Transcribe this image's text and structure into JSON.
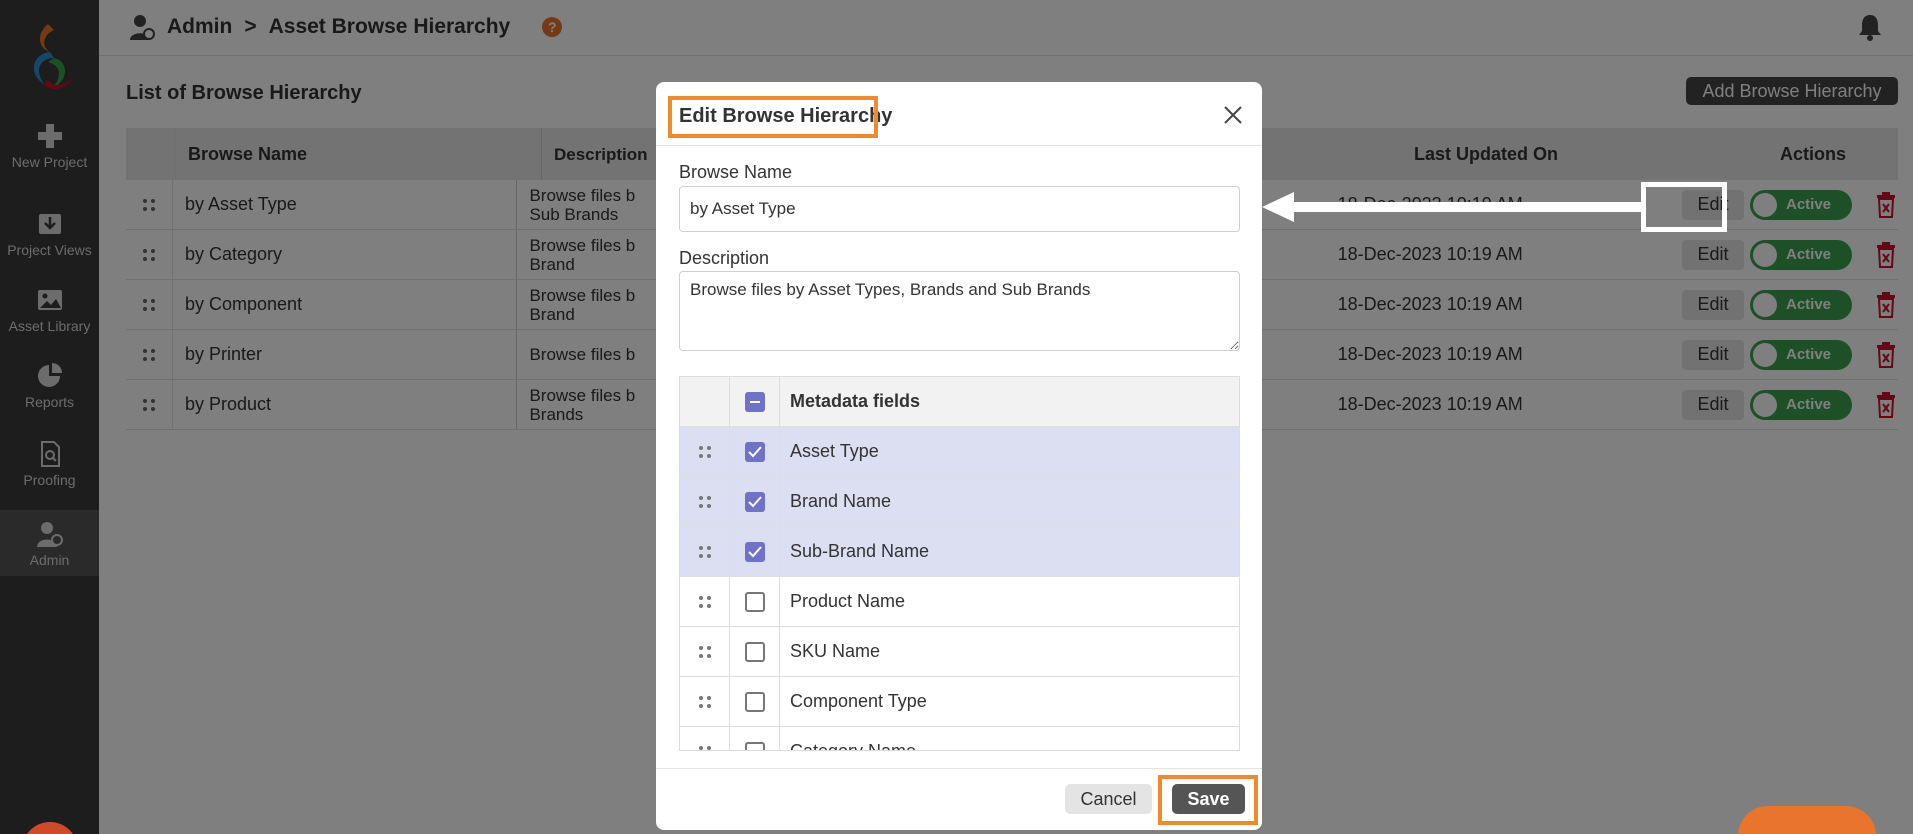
{
  "sidebar": {
    "items": [
      {
        "label": "New Project",
        "icon": "plus-icon"
      },
      {
        "label": "Project Views",
        "icon": "download-tray-icon"
      },
      {
        "label": "Asset Library",
        "icon": "image-icon"
      },
      {
        "label": "Reports",
        "icon": "pie-chart-icon"
      },
      {
        "label": "Proofing",
        "icon": "document-search-icon"
      },
      {
        "label": "Admin",
        "icon": "admin-user-icon",
        "active": true
      }
    ]
  },
  "header": {
    "section": "Admin",
    "separator": ">",
    "page": "Asset Browse Hierarchy",
    "help": "?"
  },
  "main": {
    "title": "List of Browse Hierarchy",
    "add_button": "Add Browse Hierarchy",
    "columns": [
      "Browse Name",
      "Description",
      "Last Updated On",
      "Actions"
    ],
    "rows": [
      {
        "name": "by Asset Type",
        "description": "Browse files b\nSub Brands",
        "updated": "18-Dec-2023 10:19 AM"
      },
      {
        "name": "by Category",
        "description": "Browse files b\nBrand",
        "updated": "18-Dec-2023 10:19 AM"
      },
      {
        "name": "by Component",
        "description": "Browse files b\nBrand",
        "updated": "18-Dec-2023 10:19 AM"
      },
      {
        "name": "by Printer",
        "description": "Browse files b",
        "updated": "18-Dec-2023 10:19 AM"
      },
      {
        "name": "by Product",
        "description": "Browse files b\nBrands",
        "updated": "18-Dec-2023 10:19 AM"
      }
    ],
    "edit_label": "Edit",
    "status_label": "Active"
  },
  "modal": {
    "title": "Edit Browse Hierarchy",
    "browse_name_label": "Browse Name",
    "browse_name_value": "by Asset Type",
    "description_label": "Description",
    "description_value": "Browse files by Asset Types, Brands and Sub Brands",
    "metadata_header": "Metadata fields",
    "fields": [
      {
        "label": "Asset Type",
        "checked": true
      },
      {
        "label": "Brand Name",
        "checked": true
      },
      {
        "label": "Sub-Brand Name",
        "checked": true
      },
      {
        "label": "Product Name",
        "checked": false
      },
      {
        "label": "SKU Name",
        "checked": false
      },
      {
        "label": "Component Type",
        "checked": false
      },
      {
        "label": "Category Name",
        "checked": false
      }
    ],
    "cancel": "Cancel",
    "save": "Save"
  },
  "colors": {
    "highlight": "#f08a2c",
    "active_toggle": "#3aa14c",
    "checkbox": "#6f72c7",
    "delete": "#c8102e"
  }
}
